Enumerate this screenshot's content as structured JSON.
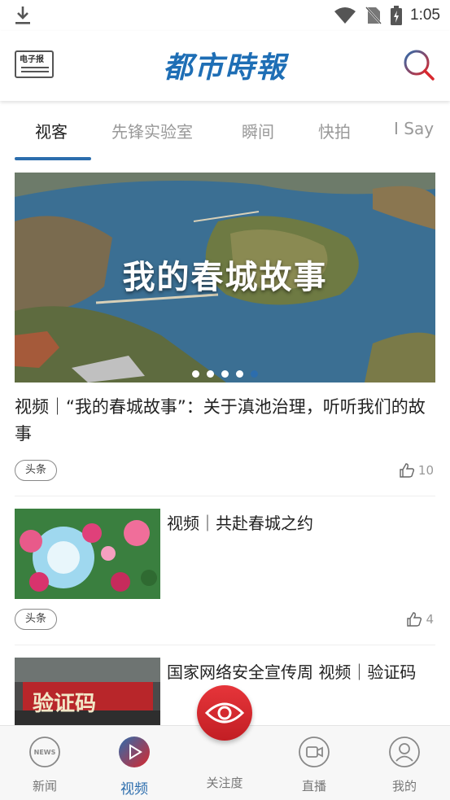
{
  "status_bar": {
    "time": "1:05",
    "icons": [
      "download-icon",
      "wifi-icon",
      "no-sim-icon",
      "battery-charging-icon"
    ]
  },
  "header": {
    "epaper_label": "电子报",
    "logo_text": "都市時報",
    "search_icon": "search-icon",
    "brand_color": "#1e6eb5"
  },
  "tabs": [
    {
      "label": "视客",
      "active": true
    },
    {
      "label": "先锋实验室",
      "active": false
    },
    {
      "label": "瞬间",
      "active": false
    },
    {
      "label": "快拍",
      "active": false
    },
    {
      "label": "I Say",
      "active": false
    }
  ],
  "banner": {
    "overlay_text": "我的春城故事",
    "slide_count": 5,
    "active_slide": 5
  },
  "feed": [
    {
      "title": "视频｜“我的春城故事”：关于滇池治理，听听我们的故事",
      "tag": "头条",
      "likes": "10"
    },
    {
      "title": "视频｜共赴春城之约",
      "tag": "头条",
      "likes": "4"
    },
    {
      "title": "国家网络安全宣传周 视频｜验证码",
      "thumb_text": "验证码"
    }
  ],
  "bottom_nav": [
    {
      "label": "新闻",
      "icon": "news-icon",
      "icon_text": "NEWS",
      "active": false
    },
    {
      "label": "视频",
      "icon": "play-icon",
      "active": true
    },
    {
      "label": "关注度",
      "icon": "eye-icon",
      "active": false
    },
    {
      "label": "直播",
      "icon": "video-camera-icon",
      "active": false
    },
    {
      "label": "我的",
      "icon": "user-icon",
      "active": false
    }
  ],
  "colors": {
    "accent": "#2c6dad",
    "focus_red": "#d8282e"
  }
}
